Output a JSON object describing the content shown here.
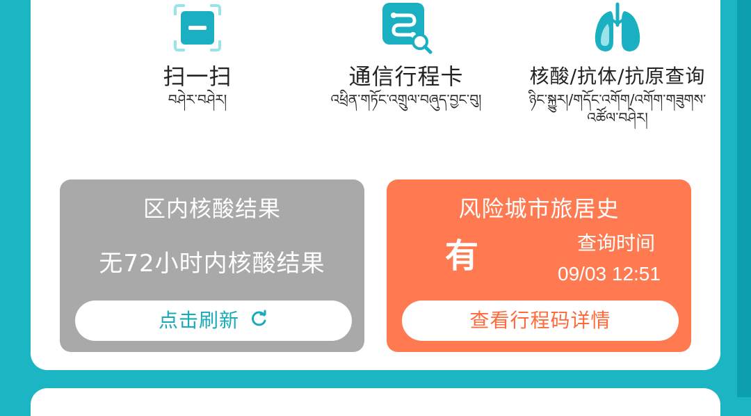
{
  "services": [
    {
      "id": "scan",
      "icon": "scan-icon",
      "label_cn": "扫一扫",
      "label_tb": "བཤེར་བཤེར།"
    },
    {
      "id": "trip",
      "icon": "travel-card-icon",
      "label_cn": "通信行程卡",
      "label_tb": "འཕྲིན་གཏོང་འགྲུལ་བཞུད་བྱང་བུ།"
    },
    {
      "id": "test",
      "icon": "lungs-icon",
      "label_cn": "核酸/抗体/抗原查询",
      "label_tb": "ཉིང་སྐྱུར།/གདོང་འགོག/འགོག་གཟུགས་འཚོལ་བཤེར།"
    }
  ],
  "nucleic_panel": {
    "title": "区内核酸结果",
    "message": "无72小时内核酸结果",
    "button": "点击刷新"
  },
  "risk_panel": {
    "title": "风险城市旅居史",
    "status": "有",
    "query_label": "查询时间",
    "query_time": "09/03 12:51",
    "button": "查看行程码详情"
  },
  "colors": {
    "background": "#1bb5c4",
    "accent": "#1aa9b8",
    "nucleic_panel": "#a9a9a9",
    "risk_panel": "#ff7a50"
  }
}
